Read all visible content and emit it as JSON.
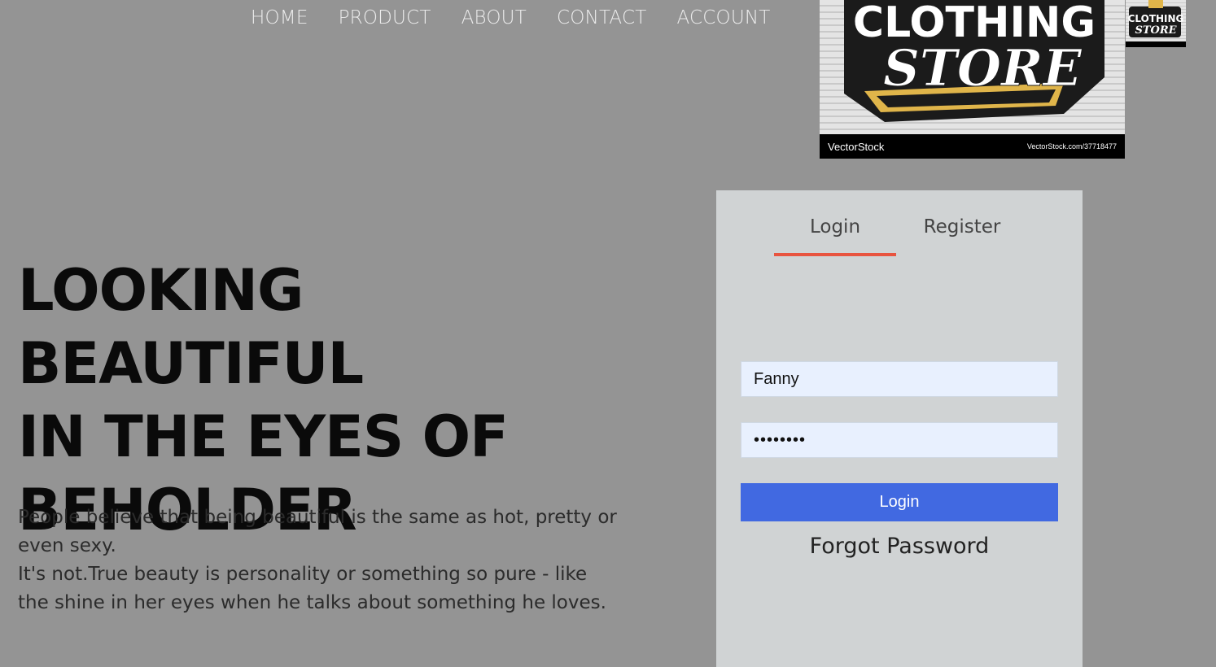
{
  "nav": {
    "items": [
      {
        "label": "HOME"
      },
      {
        "label": "PRODUCT"
      },
      {
        "label": "ABOUT"
      },
      {
        "label": "CONTACT"
      },
      {
        "label": "ACCOUNT"
      }
    ]
  },
  "logo": {
    "line1": "CLOTHING",
    "line2": "STORE",
    "watermark_brand": "VectorStock",
    "watermark_url": "VectorStock.com/37718477"
  },
  "hero": {
    "title_line1": "LOOKING BEAUTIFUL",
    "title_line2": "IN THE EYES OF",
    "title_line3": "BEHOLDER",
    "paragraph1": "People believe that being beautiful is the same as hot, pretty or even sexy.",
    "paragraph2": "It's not.True beauty is personality or something so pure - like the shine in her eyes when he talks about something he loves."
  },
  "auth": {
    "tab_login": "Login",
    "tab_register": "Register",
    "username_value": "Fanny",
    "password_value": "••••••••",
    "login_button": "Login",
    "forgot_password": "Forgot Password"
  },
  "colors": {
    "page_bg": "#949494",
    "card_bg": "#d0d3d4",
    "tab_indicator": "#e8543f",
    "button_bg": "#4169e1",
    "input_bg": "#e8f0fe"
  }
}
